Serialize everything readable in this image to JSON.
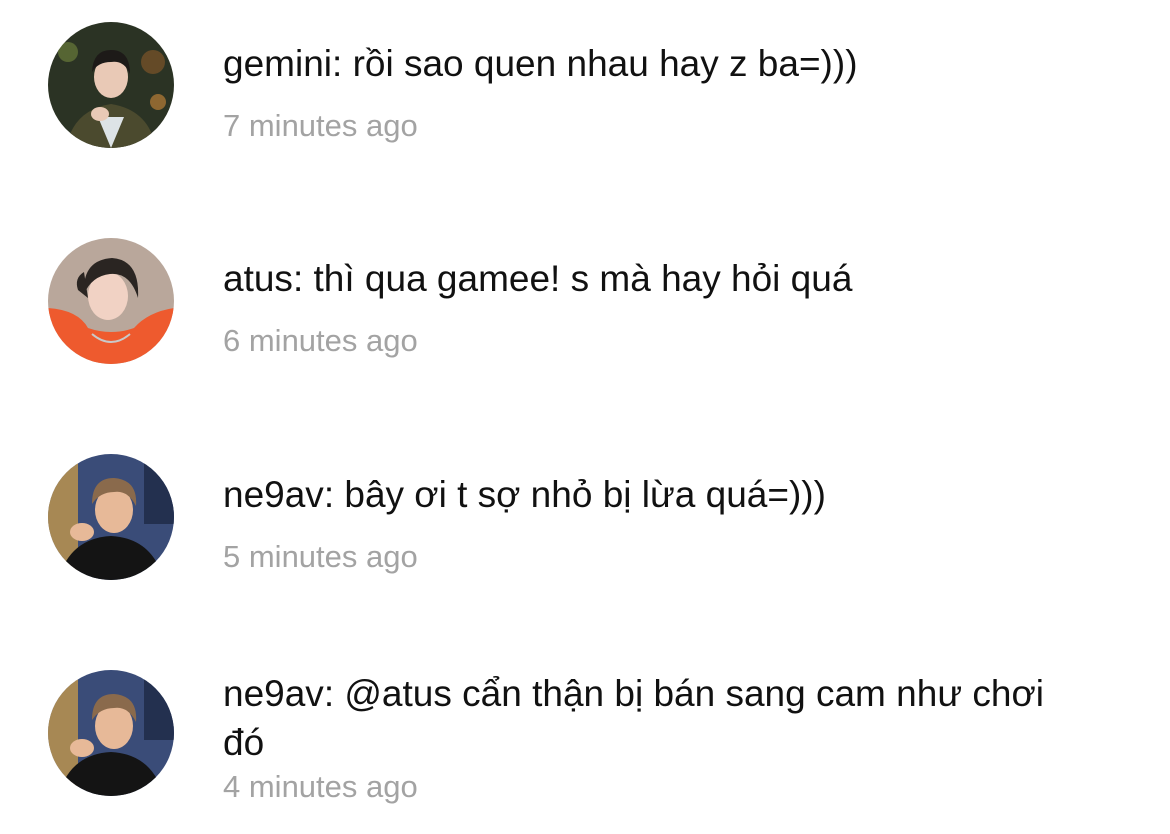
{
  "comments": [
    {
      "author": "gemini",
      "separator": ": ",
      "text": "rồi sao quen nhau hay z ba=)))",
      "timestamp": "7 minutes ago",
      "avatar_colors": {
        "bg": "#2b3324",
        "skin": "#e9c9b6",
        "hair": "#1d1a18",
        "shirt": "#4b4a2e"
      }
    },
    {
      "author": "atus",
      "separator": ": ",
      "text": "thì qua gamee! s mà hay hỏi quá",
      "timestamp": "6 minutes ago",
      "avatar_colors": {
        "bg": "#b9a79b",
        "skin": "#f1d2c4",
        "hair": "#2a2522",
        "shirt": "#ee5a2e"
      }
    },
    {
      "author": "ne9av",
      "separator": ": ",
      "text": "bây ơi t sợ nhỏ bị lừa quá=)))",
      "timestamp": "5 minutes ago",
      "avatar_colors": {
        "bg": "#3a4c78",
        "skin": "#e7b998",
        "hair": "#8a6a4c",
        "shirt": "#141414"
      }
    },
    {
      "author": "ne9av",
      "separator": ": ",
      "text": "@atus cẩn thận bị bán sang cam như chơi đó",
      "timestamp": "4 minutes ago",
      "avatar_colors": {
        "bg": "#3a4c78",
        "skin": "#e7b998",
        "hair": "#8a6a4c",
        "shirt": "#141414"
      }
    }
  ]
}
